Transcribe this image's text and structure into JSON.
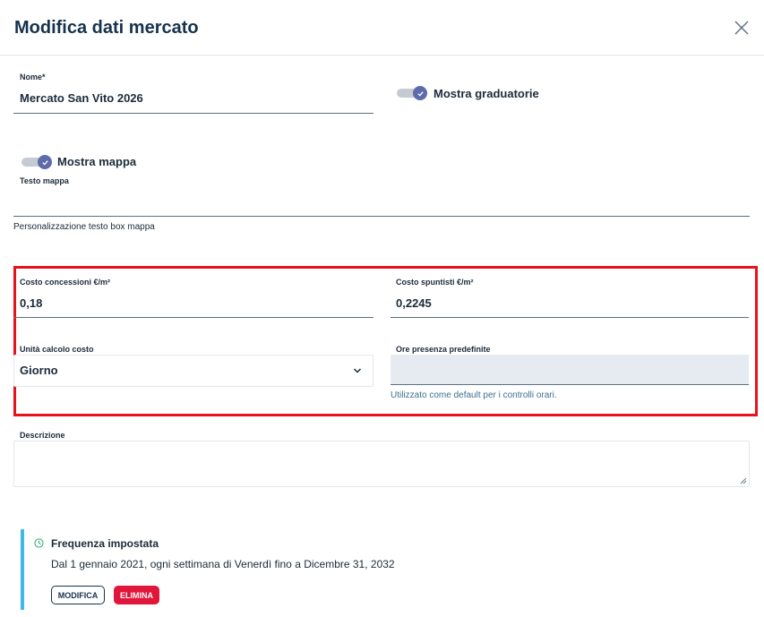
{
  "modal": {
    "title": "Modifica dati mercato",
    "close_icon": "close-icon"
  },
  "form": {
    "nome": {
      "label": "Nome*",
      "value": "Mercato San Vito 2026"
    },
    "mostra_graduatorie": {
      "label": "Mostra graduatorie",
      "checked": true
    },
    "mostra_mappa": {
      "label": "Mostra mappa",
      "checked": true
    },
    "testo_mappa": {
      "label": "Testo mappa",
      "value": "",
      "hint": "Personalizzazione testo box mappa"
    },
    "costo_concessioni": {
      "label": "Costo concessioni €/m²",
      "value": "0,18"
    },
    "costo_spuntisti": {
      "label": "Costo spuntisti €/m²",
      "value": "0,2245"
    },
    "unita_calcolo": {
      "label": "Unità calcolo costo",
      "value": "Giorno"
    },
    "ore_presenza": {
      "label": "Ore presenza predefinite",
      "value": "",
      "help": "Utilizzato come default per i controlli orari."
    },
    "descrizione": {
      "label": "Descrizione",
      "value": ""
    }
  },
  "frequenza": {
    "title": "Frequenza impostata",
    "description": "Dal 1 gennaio 2021, ogni settimana di Venerdì fino a Dicembre 31, 2032",
    "modifica_label": "MODIFICA",
    "elimina_label": "ELIMINA"
  },
  "colors": {
    "highlight": "#e8121a",
    "toggle_on": "#5d6bab",
    "accent_bar": "#3fb8e8",
    "danger": "#e0173b",
    "primary": "#17324d"
  }
}
